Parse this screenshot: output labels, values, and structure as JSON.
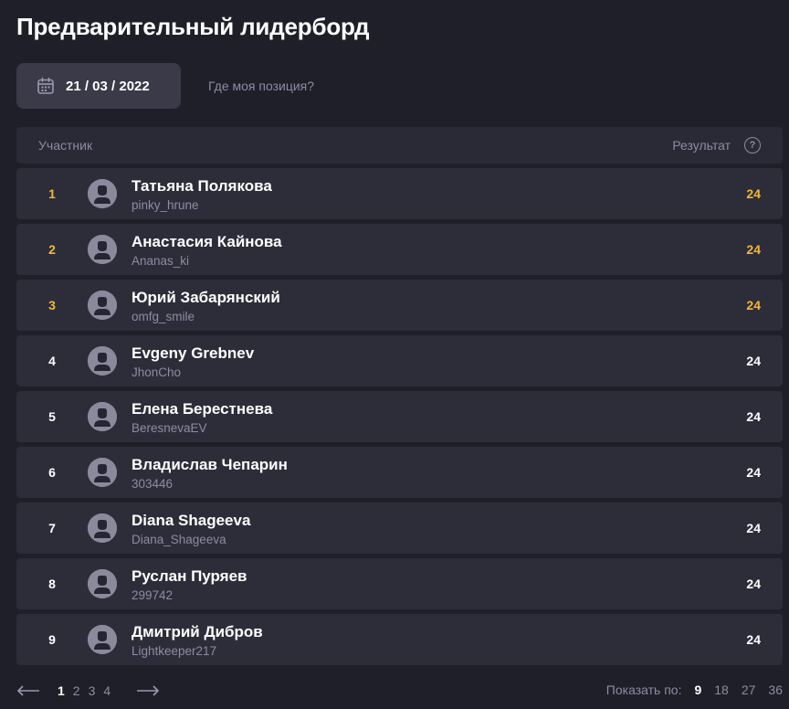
{
  "page": {
    "title": "Предварительный лидерборд"
  },
  "filters": {
    "date": "21 / 03 / 2022",
    "where_link": "Где моя позиция?"
  },
  "table": {
    "col_participant": "Участник",
    "col_result": "Результат",
    "help_glyph": "?",
    "rows": [
      {
        "rank": "1",
        "name": "Татьяна Полякова",
        "login": "pinky_hrune",
        "score": "24",
        "highlight": true
      },
      {
        "rank": "2",
        "name": "Анастасия Кайнова",
        "login": "Ananas_ki",
        "score": "24",
        "highlight": true
      },
      {
        "rank": "3",
        "name": "Юрий Забарянский",
        "login": "omfg_smile",
        "score": "24",
        "highlight": true
      },
      {
        "rank": "4",
        "name": "Evgeny Grebnev",
        "login": "JhonCho",
        "score": "24",
        "highlight": false
      },
      {
        "rank": "5",
        "name": "Елена Берестнева",
        "login": "BeresnevaEV",
        "score": "24",
        "highlight": false
      },
      {
        "rank": "6",
        "name": "Владислав Чепарин",
        "login": "303446",
        "score": "24",
        "highlight": false
      },
      {
        "rank": "7",
        "name": "Diana Shageeva",
        "login": "Diana_Shageeva",
        "score": "24",
        "highlight": false
      },
      {
        "rank": "8",
        "name": "Руслан Пуряев",
        "login": "299742",
        "score": "24",
        "highlight": false
      },
      {
        "rank": "9",
        "name": "Дмитрий Дибров",
        "login": "Lightkeeper217",
        "score": "24",
        "highlight": false
      }
    ]
  },
  "pagination": {
    "pages": [
      "1",
      "2",
      "3",
      "4"
    ],
    "current": "1",
    "per_page_label": "Показать по:",
    "per_page_options": [
      "9",
      "18",
      "27",
      "36"
    ],
    "per_page_selected": "9"
  },
  "colors": {
    "background": "#1f1f29",
    "row": "#2d2d3a",
    "accent_gold": "#f5b731",
    "muted": "#8c8ca3"
  },
  "icons": {
    "calendar": "calendar-icon",
    "help": "help-icon",
    "avatar": "user-avatar-icon",
    "prev": "arrow-left-icon",
    "next": "arrow-right-icon"
  }
}
